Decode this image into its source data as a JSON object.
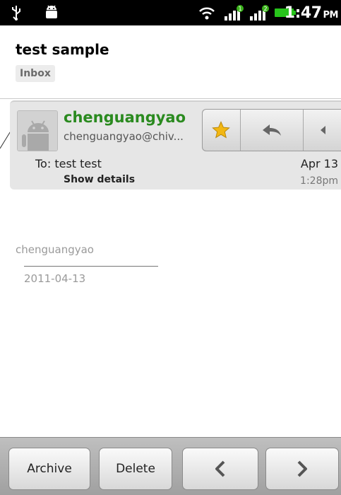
{
  "status_bar": {
    "time": "1:47",
    "ampm": "PM",
    "icons": [
      "usb-icon",
      "android-debug-icon",
      "wifi-icon",
      "signal-1-icon",
      "signal-2-icon",
      "battery-icon"
    ],
    "signal_badges": [
      "1",
      "2"
    ]
  },
  "header": {
    "subject": "test sample",
    "label": "Inbox"
  },
  "message": {
    "sender_name": "chenguangyao",
    "sender_email": "chenguangyao@chiv...",
    "to_line": "To: test test",
    "show_details": "Show details",
    "date": "Apr 13",
    "time": "1:28pm",
    "actions": [
      "star-icon",
      "reply-icon",
      "more-arrow-icon"
    ],
    "body": {
      "signature_name": "chenguangyao",
      "signature_date": "2011-04-13"
    }
  },
  "bottom_bar": {
    "archive_label": "Archive",
    "delete_label": "Delete",
    "prev_icon": "chevron-left-icon",
    "next_icon": "chevron-right-icon"
  },
  "colors": {
    "sender_name": "#2a8a1f",
    "star": "#f2b713",
    "status_bar": "#000000",
    "battery": "#27c41b"
  }
}
